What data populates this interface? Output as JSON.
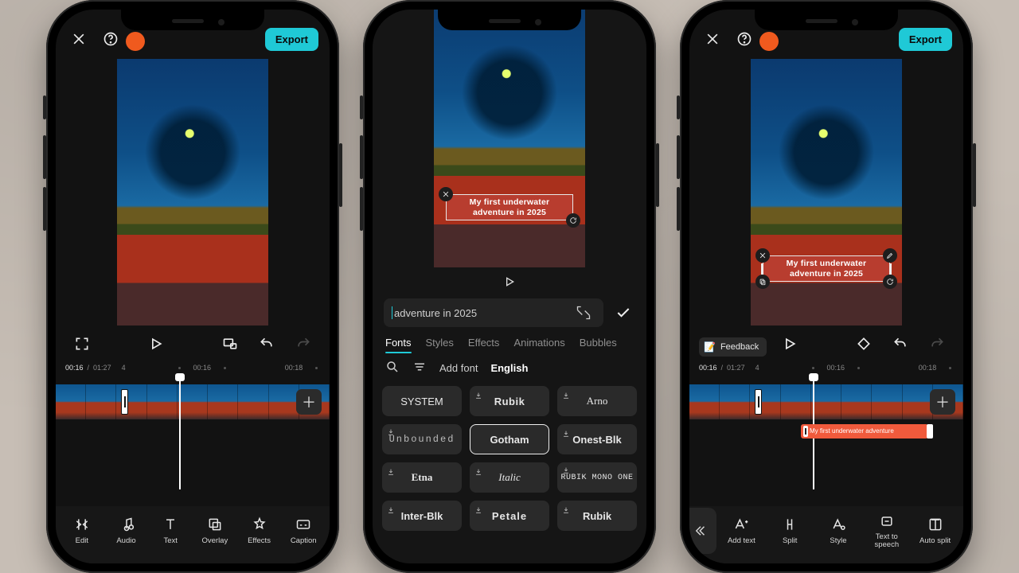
{
  "phone1": {
    "topbar": {
      "export": "Export",
      "resolution": ""
    },
    "controls": {},
    "timescale": {
      "current": "00:16",
      "total": "01:27",
      "t_a": "4",
      "t_b": "00:16",
      "t_c": "00:18"
    },
    "toolbar": {
      "edit": "Edit",
      "audio": "Audio",
      "text": "Text",
      "overlay": "Overlay",
      "effects": "Effects",
      "captions": "Caption"
    }
  },
  "phone2": {
    "overlay_line1": "My first underwater",
    "overlay_line2": "adventure in 2025",
    "input_value": "adventure in 2025",
    "tabs": {
      "fonts": "Fonts",
      "styles": "Styles",
      "effects": "Effects",
      "animations": "Animations",
      "bubbles": "Bubbles"
    },
    "font_tools": {
      "add": "Add font",
      "lang": "English"
    },
    "fonts": {
      "system": "SYSTEM",
      "rubik": "Rubik",
      "arno": "Arno",
      "unbounded": "Unbounded",
      "gotham": "Gotham",
      "onest": "Onest-Blk",
      "etna": "Etna",
      "italic": "Italic",
      "mono": "RUBIK MONO ONE",
      "inter": "Inter-Blk",
      "petale": "Petale",
      "rubik2": "Rubik"
    }
  },
  "phone3": {
    "topbar": {
      "export": "Export"
    },
    "overlay_line1": "My first underwater",
    "overlay_line2": "adventure in 2025",
    "feedback": "Feedback",
    "timescale": {
      "current": "00:16",
      "total": "01:27",
      "t_a": "4",
      "t_b": "00:16",
      "t_c": "00:18"
    },
    "text_clip": "My first underwater  adventure",
    "toolbar": {
      "add_text": "Add text",
      "split": "Split",
      "style": "Style",
      "tts": "Text to\nspeech",
      "auto": "Auto split"
    }
  }
}
